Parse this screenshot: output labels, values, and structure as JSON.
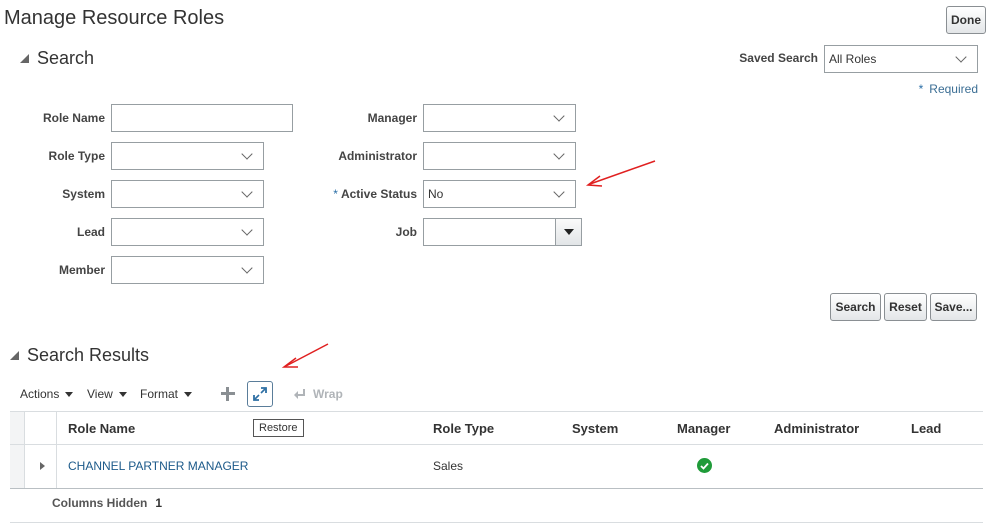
{
  "page": {
    "title": "Manage Resource Roles",
    "done_label": "Done"
  },
  "search": {
    "heading": "Search",
    "saved_search_label": "Saved Search",
    "saved_search_value": "All Roles",
    "required_note": "Required",
    "fields": {
      "role_name": {
        "label": "Role Name",
        "value": ""
      },
      "role_type": {
        "label": "Role Type",
        "value": ""
      },
      "system": {
        "label": "System",
        "value": ""
      },
      "lead": {
        "label": "Lead",
        "value": ""
      },
      "member": {
        "label": "Member",
        "value": ""
      },
      "manager": {
        "label": "Manager",
        "value": ""
      },
      "administrator": {
        "label": "Administrator",
        "value": ""
      },
      "active_status": {
        "label": "Active Status",
        "value": "No",
        "required": true
      },
      "job": {
        "label": "Job",
        "value": ""
      }
    },
    "buttons": {
      "search": "Search",
      "reset": "Reset",
      "save": "Save..."
    }
  },
  "results": {
    "heading": "Search Results",
    "toolbar": {
      "actions": "Actions",
      "view": "View",
      "format": "Format",
      "wrap": "Wrap",
      "restore_tooltip": "Restore"
    },
    "columns": [
      "Role Name",
      "Role Type",
      "System",
      "Manager",
      "Administrator",
      "Lead"
    ],
    "rows": [
      {
        "role_name": "CHANNEL PARTNER MANAGER",
        "role_type": "Sales",
        "system": "",
        "manager": true,
        "administrator": "",
        "lead": ""
      }
    ],
    "footer": {
      "columns_hidden_label": "Columns Hidden",
      "columns_hidden_value": "1"
    }
  },
  "icons": {
    "collapse_search": "triangle-down-icon",
    "collapse_results": "triangle-down-icon",
    "add": "plus-icon",
    "restore": "restore-icon",
    "wrap": "wrap-icon",
    "manager_check": "check-circle-icon",
    "annotation_arrow": "red-arrow-icon"
  },
  "colors": {
    "link": "#1c5a8a",
    "check": "#1f9b39",
    "annotation": "#e02020",
    "required": "#2a6ea6"
  }
}
